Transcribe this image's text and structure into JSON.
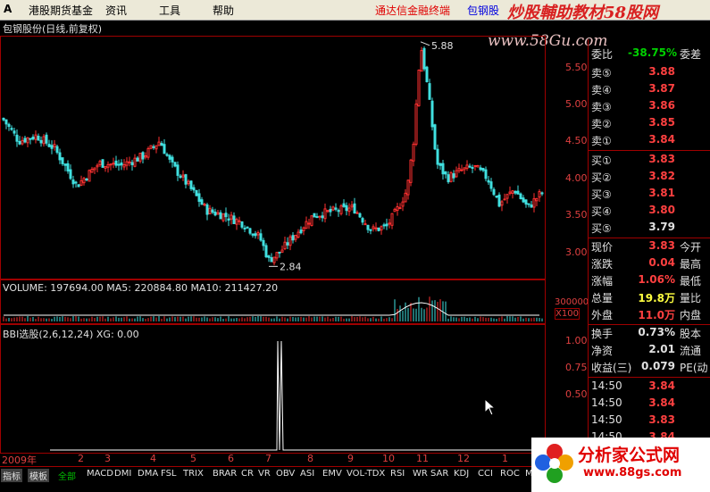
{
  "menu": {
    "logo_letter": "A",
    "items": [
      "港股期货基金",
      "资讯",
      "工具",
      "帮助"
    ],
    "promo": "通达信金融终端",
    "stock": "包钢股"
  },
  "watermark": {
    "brand": "炒股輔助教材58股网",
    "site": "www.58Gu.com"
  },
  "chart": {
    "title": "包钢股份(日线,前复权)",
    "high_label": "5.88",
    "low_label": "2.84",
    "price_ticks": [
      "5.50",
      "5.00",
      "4.50",
      "4.00",
      "3.50",
      "3.00"
    ],
    "volume_text": "VOLUME: 197694.00  MA5: 220884.80  MA10: 211427.20",
    "vol_tick": "300000",
    "vol_unit": "X100",
    "ind_text": "BBI选股(2,6,12,24)  XG: 0.00",
    "ind_ticks": [
      "1.00",
      "0.75",
      "0.50"
    ],
    "dates": [
      "2009年",
      "2",
      "3",
      "4",
      "5",
      "6",
      "7",
      "8",
      "9",
      "10",
      "11",
      "12",
      "1"
    ]
  },
  "chart_data": {
    "type": "line",
    "title": "包钢股份(日线,前复权)",
    "price_annotations": {
      "high": 5.88,
      "low": 2.84
    },
    "ylim": [
      2.7,
      5.95
    ],
    "indicator": {
      "name": "BBI选股(2,6,12,24)",
      "XG": 0.0
    },
    "volume": {
      "VOLUME": 197694.0,
      "MA5": 220884.8,
      "MA10": 211427.2
    }
  },
  "quote": {
    "webi_label": "委比",
    "webi_val": "-38.75%",
    "webi_ext": "委差",
    "sells": [
      {
        "label": "卖⑤",
        "val": "3.88"
      },
      {
        "label": "卖④",
        "val": "3.87"
      },
      {
        "label": "卖③",
        "val": "3.86"
      },
      {
        "label": "卖②",
        "val": "3.85"
      },
      {
        "label": "卖①",
        "val": "3.84"
      }
    ],
    "buys": [
      {
        "label": "买①",
        "val": "3.83"
      },
      {
        "label": "买②",
        "val": "3.82"
      },
      {
        "label": "买③",
        "val": "3.81"
      },
      {
        "label": "买④",
        "val": "3.80"
      },
      {
        "label": "买⑤",
        "val": "3.79"
      }
    ],
    "stats": [
      {
        "label": "现价",
        "val": "3.83",
        "ext": "今开"
      },
      {
        "label": "涨跌",
        "val": "0.04",
        "ext": "最高"
      },
      {
        "label": "涨幅",
        "val": "1.06%",
        "ext": "最低"
      },
      {
        "label": "总量",
        "val": "19.8万",
        "ext": "量比"
      },
      {
        "label": "外盘",
        "val": "11.0万",
        "ext": "内盘"
      }
    ],
    "stats2": [
      {
        "label": "换手",
        "val": "0.73%",
        "ext": "股本"
      },
      {
        "label": "净资",
        "val": "2.01",
        "ext": "流通"
      },
      {
        "label": "收益(三)",
        "val": "0.079",
        "ext": "PE(动"
      }
    ],
    "ticks": [
      {
        "time": "14:50",
        "price": "3.84"
      },
      {
        "time": "14:50",
        "price": "3.84"
      },
      {
        "time": "14:50",
        "price": "3.83"
      },
      {
        "time": "14:50",
        "price": "3.84"
      }
    ]
  },
  "tabs": [
    "指标",
    "模板",
    "全部",
    "MACD",
    "DMI",
    "DMA",
    "FSL",
    "TRIX",
    "BRAR",
    "CR",
    "VR",
    "OBV",
    "ASI",
    "EMV",
    "VOL-TDX",
    "RSI",
    "WR",
    "SAR",
    "KDJ",
    "CCI",
    "ROC",
    "M"
  ],
  "logo": {
    "title": "分析家公式网",
    "url": "www.88gs.com"
  }
}
